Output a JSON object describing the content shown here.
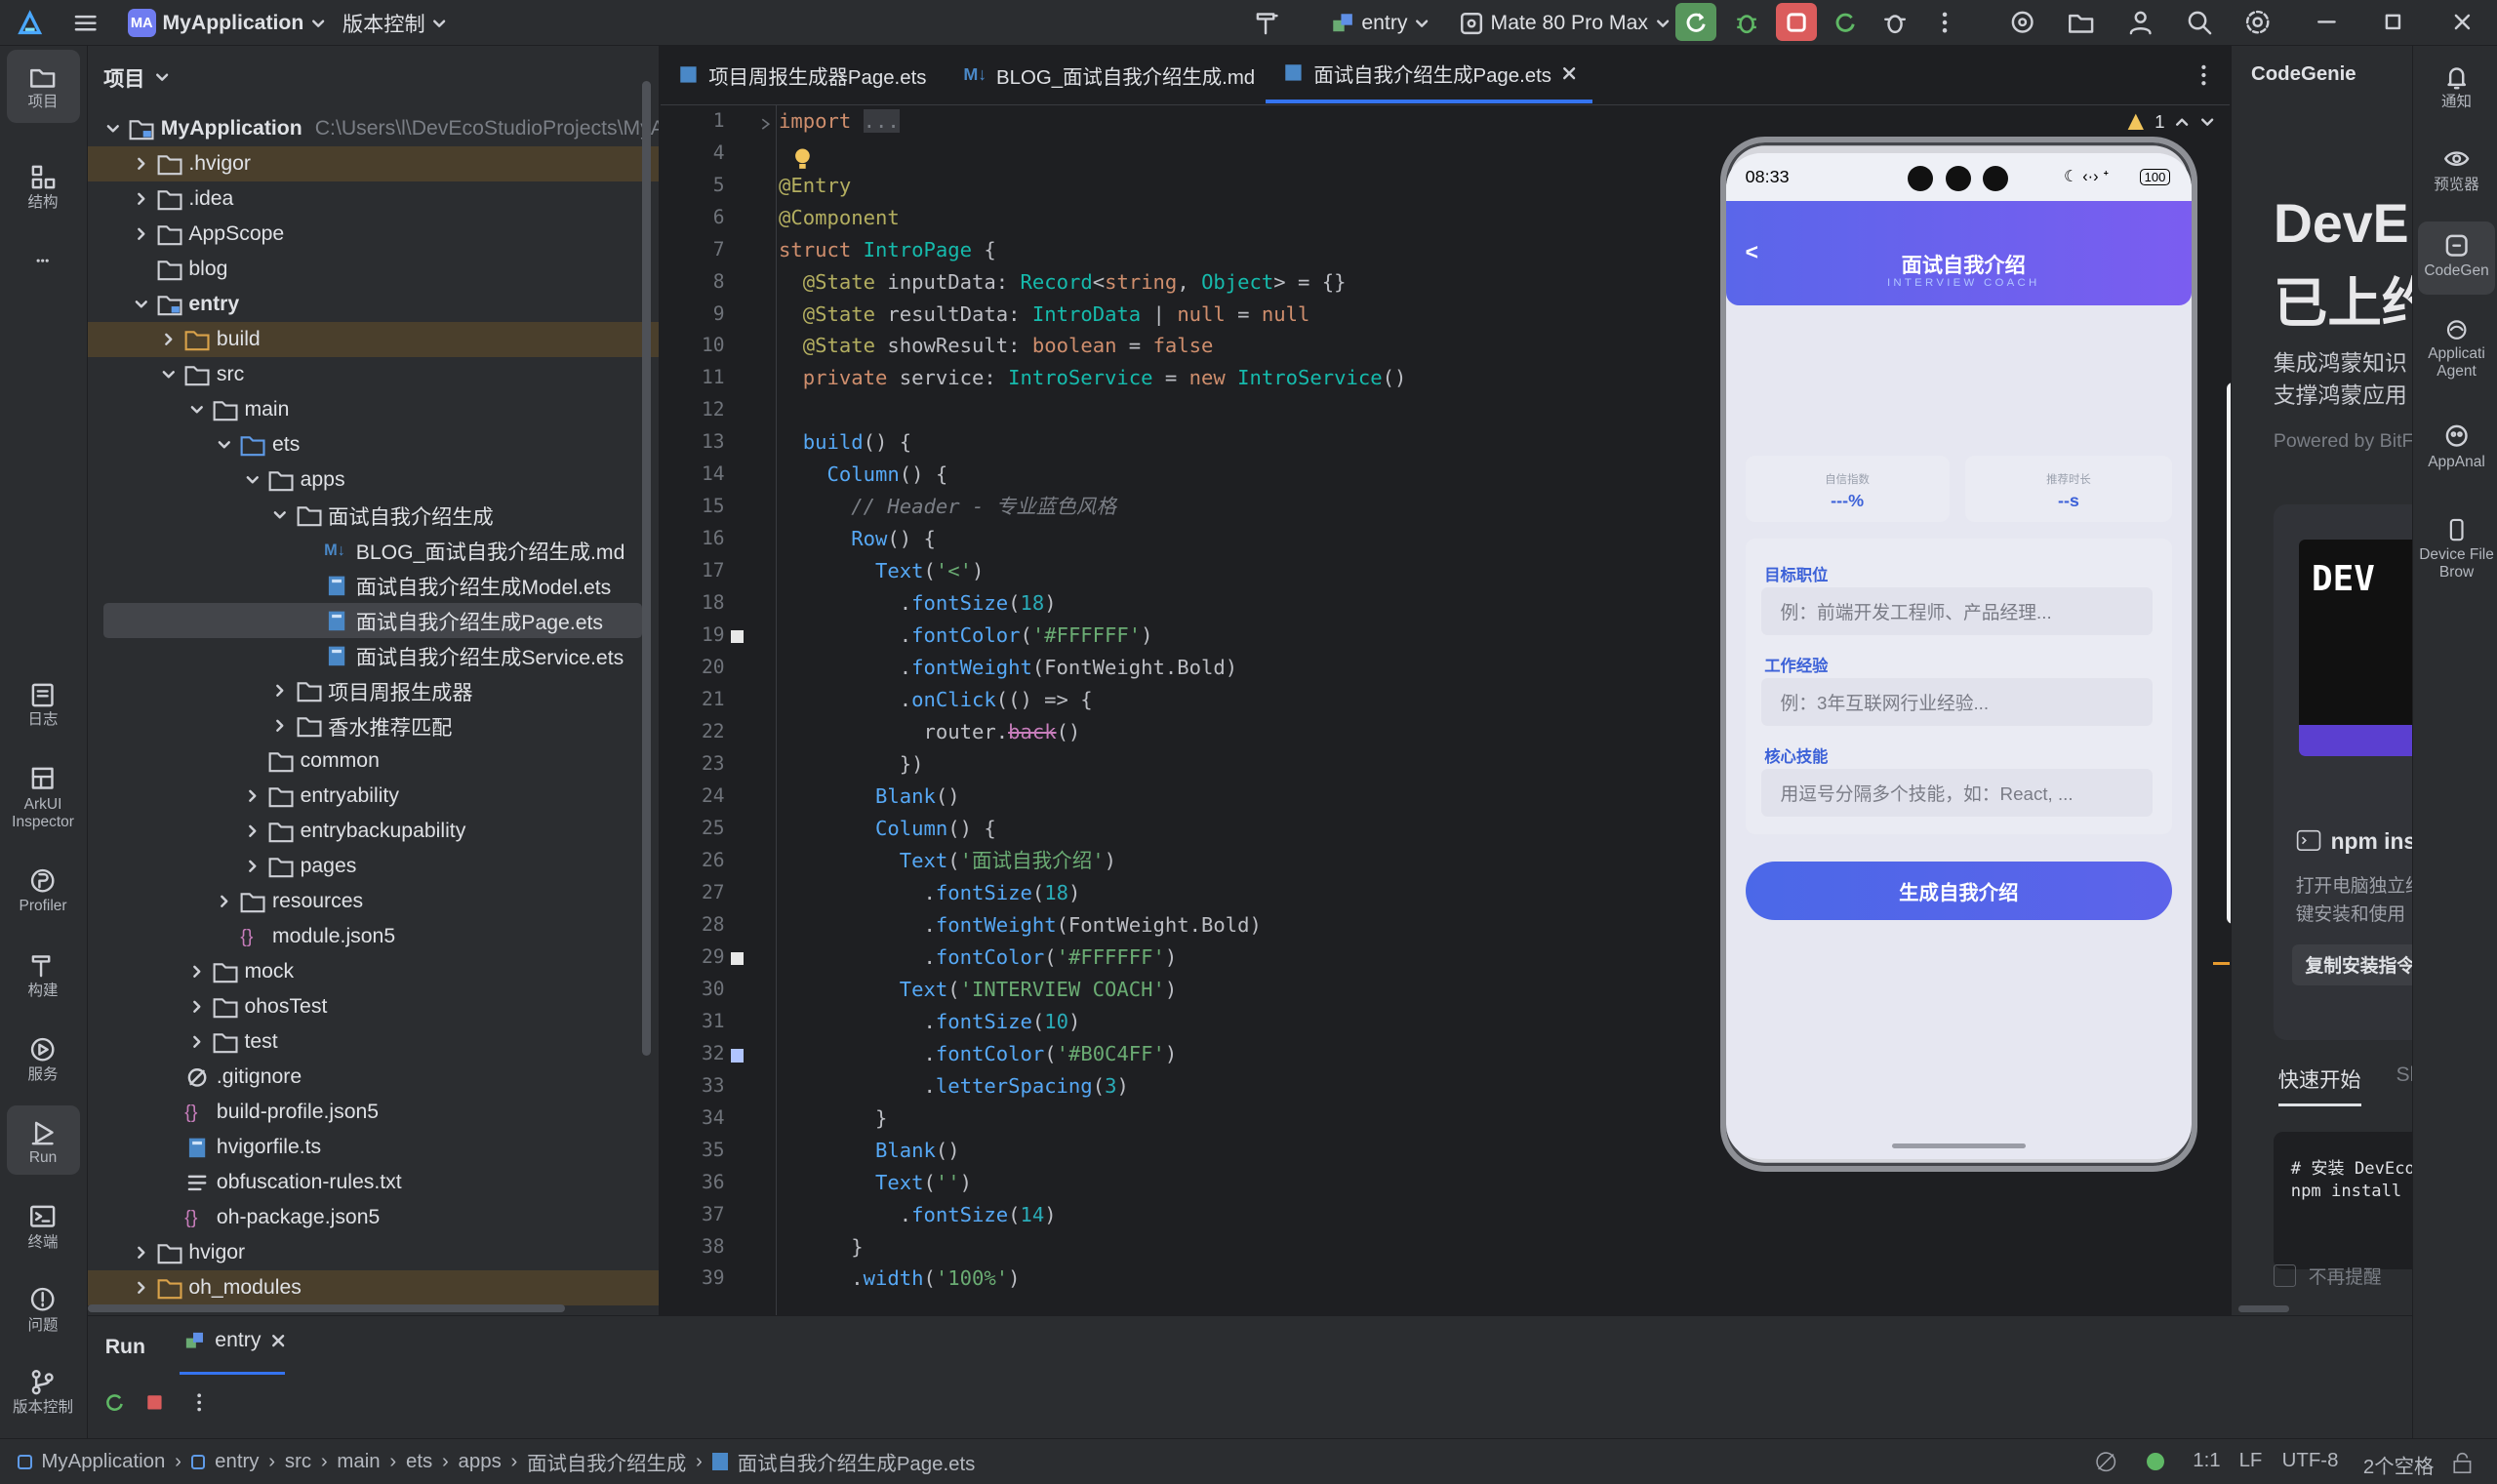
{
  "topbar": {
    "project": "MyApplication",
    "project_badge": "MA",
    "vcs": "版本控制",
    "run_config": "entry",
    "device": "Mate 80 Pro Max"
  },
  "left_strip": {
    "items": [
      {
        "label": "项目",
        "icon": "folder-icon"
      },
      {
        "label": "结构",
        "icon": "structure-icon"
      },
      {
        "label": "",
        "icon": "more-icon"
      },
      {
        "label": "日志",
        "icon": "log-icon"
      },
      {
        "label": "ArkUI Inspector",
        "icon": "inspector-icon"
      },
      {
        "label": "Profiler",
        "icon": "profiler-icon"
      },
      {
        "label": "构建",
        "icon": "build-icon"
      },
      {
        "label": "服务",
        "icon": "services-icon"
      },
      {
        "label": "Run",
        "icon": "run-icon"
      },
      {
        "label": "终端",
        "icon": "terminal-icon"
      },
      {
        "label": "问题",
        "icon": "problems-icon"
      },
      {
        "label": "版本控制",
        "icon": "vcs-icon"
      }
    ]
  },
  "project_panel": {
    "title": "项目",
    "root_path": "C:\\Users\\l\\DevEcoStudioProjects\\MyApplic",
    "tree": [
      {
        "label": "MyApplication",
        "depth": 0,
        "type": "module",
        "open": true,
        "bold": true
      },
      {
        "label": ".hvigor",
        "depth": 1,
        "type": "folder",
        "open": false,
        "hl": true
      },
      {
        "label": ".idea",
        "depth": 1,
        "type": "folder",
        "open": false
      },
      {
        "label": "AppScope",
        "depth": 1,
        "type": "folder",
        "open": false
      },
      {
        "label": "blog",
        "depth": 1,
        "type": "folder",
        "leaf": true
      },
      {
        "label": "entry",
        "depth": 1,
        "type": "module",
        "open": true,
        "bold": true
      },
      {
        "label": "build",
        "depth": 2,
        "type": "folder-orange",
        "open": false,
        "hl": true
      },
      {
        "label": "src",
        "depth": 2,
        "type": "folder",
        "open": true
      },
      {
        "label": "main",
        "depth": 3,
        "type": "folder",
        "open": true
      },
      {
        "label": "ets",
        "depth": 4,
        "type": "folder-blue",
        "open": true
      },
      {
        "label": "apps",
        "depth": 5,
        "type": "folder",
        "open": true
      },
      {
        "label": "面试自我介绍生成",
        "depth": 6,
        "type": "folder",
        "open": true
      },
      {
        "label": "BLOG_面试自我介绍生成.md",
        "depth": 7,
        "type": "md",
        "leaf": true
      },
      {
        "label": "面试自我介绍生成Model.ets",
        "depth": 7,
        "type": "ets",
        "leaf": true
      },
      {
        "label": "面试自我介绍生成Page.ets",
        "depth": 7,
        "type": "ets",
        "leaf": true,
        "sel": true
      },
      {
        "label": "面试自我介绍生成Service.ets",
        "depth": 7,
        "type": "ets",
        "leaf": true
      },
      {
        "label": "项目周报生成器",
        "depth": 6,
        "type": "folder",
        "open": false
      },
      {
        "label": "香水推荐匹配",
        "depth": 6,
        "type": "folder",
        "open": false
      },
      {
        "label": "common",
        "depth": 5,
        "type": "folder",
        "leaf": true
      },
      {
        "label": "entryability",
        "depth": 5,
        "type": "folder",
        "open": false,
        "dim": true
      },
      {
        "label": "entrybackupability",
        "depth": 5,
        "type": "folder",
        "open": false
      },
      {
        "label": "pages",
        "depth": 5,
        "type": "folder",
        "open": false
      },
      {
        "label": "resources",
        "depth": 4,
        "type": "folder",
        "open": false
      },
      {
        "label": "module.json5",
        "depth": 4,
        "type": "json",
        "leaf": true
      },
      {
        "label": "mock",
        "depth": 3,
        "type": "folder",
        "open": false
      },
      {
        "label": "ohosTest",
        "depth": 3,
        "type": "folder",
        "open": false
      },
      {
        "label": "test",
        "depth": 3,
        "type": "folder",
        "open": false
      },
      {
        "label": ".gitignore",
        "depth": 2,
        "type": "ignore",
        "leaf": true
      },
      {
        "label": "build-profile.json5",
        "depth": 2,
        "type": "json",
        "leaf": true
      },
      {
        "label": "hvigorfile.ts",
        "depth": 2,
        "type": "ets",
        "leaf": true
      },
      {
        "label": "obfuscation-rules.txt",
        "depth": 2,
        "type": "text",
        "leaf": true
      },
      {
        "label": "oh-package.json5",
        "depth": 2,
        "type": "json",
        "leaf": true
      },
      {
        "label": "hvigor",
        "depth": 1,
        "type": "folder",
        "open": false
      },
      {
        "label": "oh_modules",
        "depth": 1,
        "type": "folder-orange",
        "open": false,
        "hl": true
      }
    ]
  },
  "tabs": [
    {
      "label": "项目周报生成器Page.ets",
      "icon": "ets"
    },
    {
      "label": "BLOG_面试自我介绍生成.md",
      "icon": "md"
    },
    {
      "label": "面试自我介绍生成Page.ets",
      "icon": "ets",
      "active": true
    }
  ],
  "editor": {
    "warnings": "1",
    "line_numbers": [
      "1",
      "4",
      "5",
      "6",
      "7",
      "8",
      "9",
      "10",
      "11",
      "12",
      "13",
      "14",
      "15",
      "16",
      "17",
      "18",
      "19",
      "20",
      "21",
      "22",
      "23",
      "24",
      "25",
      "26",
      "27",
      "28",
      "29",
      "30",
      "31",
      "32",
      "33",
      "34",
      "35",
      "36",
      "37",
      "38",
      "39"
    ],
    "lines": [
      [
        [
          "k",
          "import"
        ],
        [
          "w",
          " "
        ],
        [
          "c",
          "..."
        ]
      ],
      [],
      [
        [
          "a",
          "@Entry"
        ]
      ],
      [
        [
          "a",
          "@Component"
        ]
      ],
      [
        [
          "k",
          "struct"
        ],
        [
          "w",
          " "
        ],
        [
          "t",
          "IntroPage"
        ],
        [
          "w",
          " {"
        ]
      ],
      [
        [
          "w",
          "  "
        ],
        [
          "a",
          "@State"
        ],
        [
          "w",
          " inputData: "
        ],
        [
          "t",
          "Record"
        ],
        [
          "w",
          "<"
        ],
        [
          "k",
          "string"
        ],
        [
          "w",
          ", "
        ],
        [
          "t",
          "Object"
        ],
        [
          "w",
          "> = {}"
        ]
      ],
      [
        [
          "w",
          "  "
        ],
        [
          "a",
          "@State"
        ],
        [
          "w",
          " resultData: "
        ],
        [
          "t",
          "IntroData"
        ],
        [
          "w",
          " | "
        ],
        [
          "k",
          "null"
        ],
        [
          "w",
          " = "
        ],
        [
          "k",
          "null"
        ]
      ],
      [
        [
          "w",
          "  "
        ],
        [
          "a",
          "@State"
        ],
        [
          "w",
          " showResult: "
        ],
        [
          "k",
          "boolean"
        ],
        [
          "w",
          " = "
        ],
        [
          "k",
          "false"
        ]
      ],
      [
        [
          "w",
          "  "
        ],
        [
          "k",
          "private"
        ],
        [
          "w",
          " service: "
        ],
        [
          "t",
          "IntroService"
        ],
        [
          "w",
          " = "
        ],
        [
          "k",
          "new"
        ],
        [
          "w",
          " "
        ],
        [
          "t",
          "IntroService"
        ],
        [
          "w",
          "()"
        ]
      ],
      [],
      [
        [
          "w",
          "  "
        ],
        [
          "f",
          "build"
        ],
        [
          "w",
          "() {"
        ]
      ],
      [
        [
          "w",
          "    "
        ],
        [
          "f",
          "Column"
        ],
        [
          "w",
          "() {"
        ]
      ],
      [
        [
          "w",
          "      "
        ],
        [
          "c",
          "// Header - 专业蓝色风格"
        ]
      ],
      [
        [
          "w",
          "      "
        ],
        [
          "f",
          "Row"
        ],
        [
          "w",
          "() {"
        ]
      ],
      [
        [
          "w",
          "        "
        ],
        [
          "f",
          "Text"
        ],
        [
          "w",
          "("
        ],
        [
          "s",
          "'<'"
        ],
        [
          "w",
          ")"
        ]
      ],
      [
        [
          "w",
          "          ."
        ],
        [
          "f",
          "fontSize"
        ],
        [
          "w",
          "("
        ],
        [
          "n",
          "18"
        ],
        [
          "w",
          ")"
        ]
      ],
      [
        [
          "w",
          "          ."
        ],
        [
          "f",
          "fontColor"
        ],
        [
          "w",
          "("
        ],
        [
          "s",
          "'#FFFFFF'"
        ],
        [
          "w",
          ")"
        ]
      ],
      [
        [
          "w",
          "          ."
        ],
        [
          "f",
          "fontWeight"
        ],
        [
          "w",
          "(FontWeight.Bold)"
        ]
      ],
      [
        [
          "w",
          "          ."
        ],
        [
          "f",
          "onClick"
        ],
        [
          "w",
          "(() => {"
        ]
      ],
      [
        [
          "w",
          "            router."
        ],
        [
          "p",
          "back"
        ],
        [
          "w",
          "()"
        ]
      ],
      [
        [
          "w",
          "          })"
        ]
      ],
      [
        [
          "w",
          "        "
        ],
        [
          "f",
          "Blank"
        ],
        [
          "w",
          "()"
        ]
      ],
      [
        [
          "w",
          "        "
        ],
        [
          "f",
          "Column"
        ],
        [
          "w",
          "() {"
        ]
      ],
      [
        [
          "w",
          "          "
        ],
        [
          "f",
          "Text"
        ],
        [
          "w",
          "("
        ],
        [
          "s",
          "'面试自我介绍'"
        ],
        [
          "w",
          ")"
        ]
      ],
      [
        [
          "w",
          "            ."
        ],
        [
          "f",
          "fontSize"
        ],
        [
          "w",
          "("
        ],
        [
          "n",
          "18"
        ],
        [
          "w",
          ")"
        ]
      ],
      [
        [
          "w",
          "            ."
        ],
        [
          "f",
          "fontWeight"
        ],
        [
          "w",
          "(FontWeight.Bold)"
        ]
      ],
      [
        [
          "w",
          "            ."
        ],
        [
          "f",
          "fontColor"
        ],
        [
          "w",
          "("
        ],
        [
          "s",
          "'#FFFFFF'"
        ],
        [
          "w",
          ")"
        ]
      ],
      [
        [
          "w",
          "          "
        ],
        [
          "f",
          "Text"
        ],
        [
          "w",
          "("
        ],
        [
          "s",
          "'INTERVIEW COACH'"
        ],
        [
          "w",
          ")"
        ]
      ],
      [
        [
          "w",
          "            ."
        ],
        [
          "f",
          "fontSize"
        ],
        [
          "w",
          "("
        ],
        [
          "n",
          "10"
        ],
        [
          "w",
          ")"
        ]
      ],
      [
        [
          "w",
          "            ."
        ],
        [
          "f",
          "fontColor"
        ],
        [
          "w",
          "("
        ],
        [
          "s",
          "'#B0C4FF'"
        ],
        [
          "w",
          ")"
        ]
      ],
      [
        [
          "w",
          "            ."
        ],
        [
          "f",
          "letterSpacing"
        ],
        [
          "w",
          "("
        ],
        [
          "n",
          "3"
        ],
        [
          "w",
          ")"
        ]
      ],
      [
        [
          "w",
          "        }"
        ]
      ],
      [
        [
          "w",
          "        "
        ],
        [
          "f",
          "Blank"
        ],
        [
          "w",
          "()"
        ]
      ],
      [
        [
          "w",
          "        "
        ],
        [
          "f",
          "Text"
        ],
        [
          "w",
          "("
        ],
        [
          "s",
          "''"
        ],
        [
          "w",
          ")"
        ]
      ],
      [
        [
          "w",
          "          ."
        ],
        [
          "f",
          "fontSize"
        ],
        [
          "w",
          "("
        ],
        [
          "n",
          "14"
        ],
        [
          "w",
          ")"
        ]
      ],
      [
        [
          "w",
          "      }"
        ]
      ],
      [
        [
          "w",
          "      ."
        ],
        [
          "f",
          "width"
        ],
        [
          "w",
          "("
        ],
        [
          "s",
          "'100%'"
        ],
        [
          "w",
          ")"
        ]
      ]
    ]
  },
  "phone": {
    "time": "08:33",
    "battery": "100",
    "back": "<",
    "title": "面试自我介绍",
    "subtitle": "INTERVIEW COACH",
    "stat1_label": "自信指数",
    "stat1_value": "---%",
    "stat2_label": "推荐时长",
    "stat2_value": "--s",
    "field1_label": "目标职位",
    "field1_placeholder": "例：前端开发工程师、产品经理...",
    "field2_label": "工作经验",
    "field2_placeholder": "例：3年互联网行业经验...",
    "field3_label": "核心技能",
    "field3_placeholder": "用逗号分隔多个技能，如：React, ...",
    "button": "生成自我介绍"
  },
  "codegenie": {
    "title": "CodeGenie",
    "hero1": "DevE",
    "hero2": "已上约",
    "desc1": "集成鸿蒙知识",
    "desc2": "支撑鸿蒙应用",
    "powered": "Powered by BitFu",
    "npm_title": "npm ins",
    "npm_desc1": "打开电脑独立终",
    "npm_desc2": "键安装和使用",
    "copy_btn": "复制安装指令",
    "tab_active": "快速开始",
    "tab_other": "Sl",
    "code1": "# 安装 DevEco",
    "code2": "npm install -",
    "checkbox": "不再提醒"
  },
  "right_strip": {
    "items": [
      {
        "label": "通知",
        "icon": "bell-icon"
      },
      {
        "label": "预览器",
        "icon": "eye-icon"
      },
      {
        "label": "CodeGen",
        "icon": "codegenie-icon"
      },
      {
        "label": "Applicati Agent",
        "icon": "agent-icon"
      },
      {
        "label": "AppAnal",
        "icon": "analyzer-icon"
      },
      {
        "label": "Device File Brow",
        "icon": "device-icon"
      }
    ]
  },
  "bottom": {
    "run_tab": "Run",
    "entry_tab": "entry"
  },
  "statusbar": {
    "crumbs": [
      "MyApplication",
      "entry",
      "src",
      "main",
      "ets",
      "apps",
      "面试自我介绍生成",
      "面试自我介绍生成Page.ets"
    ],
    "position": "1:1",
    "line_sep": "LF",
    "encoding": "UTF-8",
    "indent": "2个空格"
  }
}
